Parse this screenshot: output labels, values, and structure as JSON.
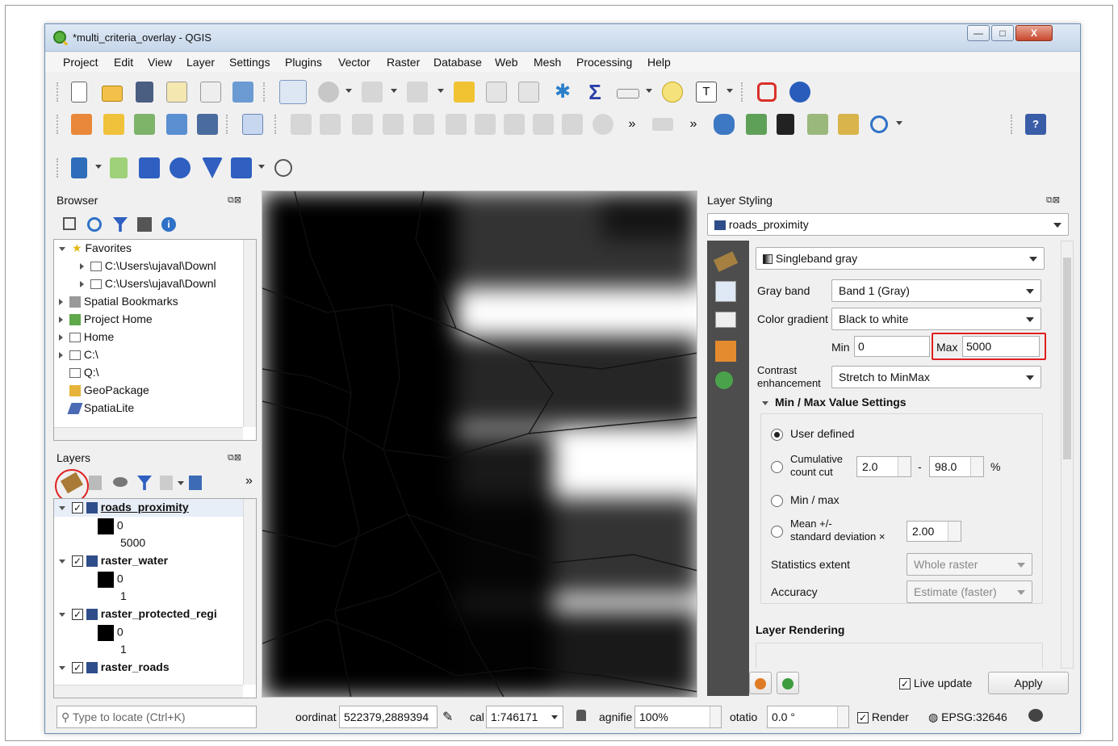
{
  "window": {
    "title": "*multi_criteria_overlay - QGIS",
    "min": "—",
    "max": "□",
    "close": "X"
  },
  "menu": [
    "Project",
    "Edit",
    "View",
    "Layer",
    "Settings",
    "Plugins",
    "Vector",
    "Raster",
    "Database",
    "Web",
    "Mesh",
    "Processing",
    "Help"
  ],
  "toolbar": {
    "more": "»",
    "help": "?"
  },
  "browser": {
    "title": "Browser",
    "items": [
      {
        "label": "Favorites"
      },
      {
        "label": "C:\\Users\\ujaval\\Downl"
      },
      {
        "label": "C:\\Users\\ujaval\\Downl"
      },
      {
        "label": "Spatial Bookmarks"
      },
      {
        "label": "Project Home"
      },
      {
        "label": "Home"
      },
      {
        "label": "C:\\"
      },
      {
        "label": "Q:\\"
      },
      {
        "label": "GeoPackage"
      },
      {
        "label": "SpatiaLite"
      }
    ]
  },
  "layers": {
    "title": "Layers",
    "more": "»",
    "items": [
      {
        "name": "roads_proximity",
        "checked": "✓",
        "legend": [
          "0",
          "5000"
        ]
      },
      {
        "name": "raster_water",
        "checked": "✓",
        "legend": [
          "0",
          "1"
        ]
      },
      {
        "name": "raster_protected_regi",
        "checked": "✓",
        "legend": [
          "0",
          "1"
        ]
      },
      {
        "name": "raster_roads",
        "checked": "✓"
      }
    ]
  },
  "styling": {
    "title": "Layer Styling",
    "layer": "roads_proximity",
    "renderer": "Singleband gray",
    "gray_band_label": "Gray band",
    "gray_band": "Band 1 (Gray)",
    "gradient_label": "Color gradient",
    "gradient": "Black to white",
    "min_label": "Min",
    "min": "0",
    "max_label": "Max",
    "max": "5000",
    "contrast_label1": "Contrast",
    "contrast_label2": "enhancement",
    "contrast": "Stretch to MinMax",
    "minmax_group": "Min / Max Value Settings",
    "user_defined": "User defined",
    "cumulative1": "Cumulative",
    "cumulative2": "count cut",
    "cum_low": "2.0",
    "cum_dash": "-",
    "cum_high": "98.0",
    "cum_pct": "%",
    "minmax": "Min / max",
    "mean1": "Mean +/-",
    "mean2": "standard deviation ×",
    "std": "2.00",
    "stats_extent_label": "Statistics extent",
    "stats_extent": "Whole raster",
    "accuracy_label": "Accuracy",
    "accuracy": "Estimate (faster)",
    "layer_rendering": "Layer Rendering",
    "live_update": "Live update",
    "live_checked": "✓",
    "apply": "Apply"
  },
  "status": {
    "locate_placeholder": "Type to locate (Ctrl+K)",
    "coord_label": "oordinat",
    "coord": "522379,2889394",
    "scale_label": "cal",
    "scale": "1:746171",
    "magnifier_label": "agnifie",
    "magnifier": "100%",
    "rotation_label": "otatio",
    "rotation": "0.0 °",
    "render_label": "Render",
    "render_checked": "✓",
    "crs": "EPSG:32646"
  },
  "colors": {
    "accent_red": "#e02020",
    "titlebar": "#c6d7ea"
  }
}
